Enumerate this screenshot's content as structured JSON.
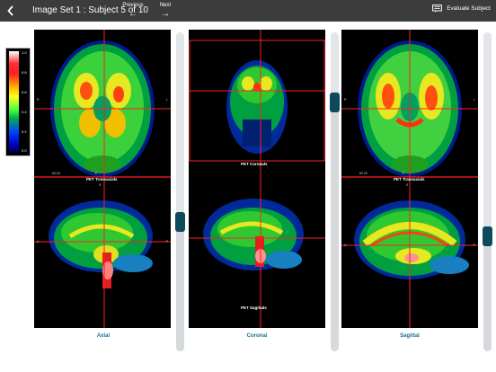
{
  "header": {
    "title": "Image Set 1 : Subject 5 of 10",
    "previous_label": "Previous",
    "next_label": "Next",
    "evaluate_label": "Evaluate Subject"
  },
  "colorbar": {
    "ticks": [
      "1.0",
      "0.8",
      "0.6",
      "0.4",
      "0.2",
      "0.0"
    ]
  },
  "columns": [
    {
      "label": "Axial",
      "top_panel": {
        "caption": "PET Transaxials",
        "left_mark": "R",
        "right_mark": "L",
        "corner_value": "60.29",
        "bottom_mark": "P"
      },
      "bottom_panel": {
        "top_mark": "S",
        "left_mark": "A",
        "right_mark": "P"
      },
      "slider_value": 0.4
    },
    {
      "label": "Coronal",
      "top_panel": {
        "caption": "PET Coronals"
      },
      "bottom_panel": {
        "caption": "PET Sagittals"
      },
      "slider_value": 0.8
    },
    {
      "label": "Sagittal",
      "top_panel": {
        "caption": "PET Transaxials",
        "left_mark": "R",
        "right_mark": "L",
        "corner_value": "60.29",
        "bottom_mark": "P"
      },
      "bottom_panel": {
        "top_mark": "S",
        "left_mark": "A",
        "right_mark": "P"
      },
      "slider_value": 0.35
    }
  ],
  "colors": {
    "topbar": "#3c3c3c",
    "slider_knob": "#0f4a5c",
    "label": "#1e6d8c",
    "crosshair": "#ff2020"
  }
}
